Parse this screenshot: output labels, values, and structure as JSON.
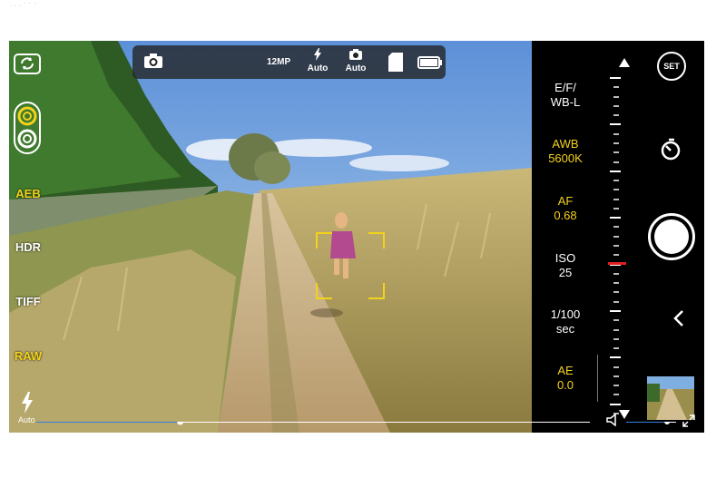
{
  "faded_header": "…···",
  "left_column": {
    "modes": [
      {
        "label": "AEB",
        "active": true
      },
      {
        "label": "HDR",
        "active": false
      },
      {
        "label": "TIFF",
        "active": false
      },
      {
        "label": "RAW",
        "active": true
      }
    ],
    "flash_label": "Auto",
    "icons": [
      "switch-camera-icon",
      "lens-selector-icon",
      "flash-icon"
    ]
  },
  "top_bar": {
    "resolution": "12MP",
    "flash": "Auto",
    "mode": "Auto",
    "icons": [
      "camera-icon",
      "flash-icon",
      "camera-mode-icon",
      "sd-card-icon",
      "battery-icon"
    ]
  },
  "right_panel": {
    "focus_mode": {
      "line1": "E/F/",
      "line2": "WB-L"
    },
    "white_balance": {
      "line1": "AWB",
      "line2": "5600K"
    },
    "focus": {
      "line1": "AF",
      "line2": "0.68"
    },
    "iso": {
      "line1": "ISO",
      "line2": "25"
    },
    "shutter": {
      "line1": "1/100",
      "line2": "sec"
    },
    "exposure": {
      "line1": "AE",
      "line2": "0.0"
    },
    "settings_label": "SET",
    "ruler_level": 0.55
  },
  "timeline": {
    "position": 0.26
  },
  "volume": {
    "level": 0.82
  },
  "colors": {
    "accent_yellow": "#f3d21b",
    "ruler_marker": "#e02020",
    "timeline_blue": "#3a7de0"
  }
}
